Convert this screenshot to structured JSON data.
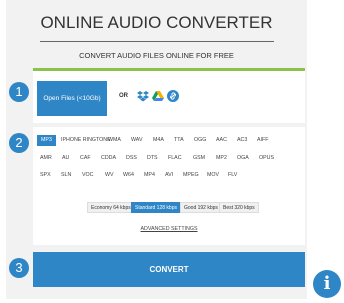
{
  "header": {
    "title": "ONLINE AUDIO CONVERTER",
    "subtitle": "CONVERT AUDIO FILES ONLINE FOR FREE"
  },
  "steps": [
    "1",
    "2",
    "3"
  ],
  "upload": {
    "open_label": "Open Files (<10Gb)",
    "or_label": "OR",
    "sources": [
      "dropbox-icon",
      "google-drive-icon",
      "url-link-icon"
    ]
  },
  "formats": {
    "row1": [
      "MP3",
      "IPHONE RINGTONE",
      "WMA",
      "WAV",
      "M4A",
      "TTA",
      "OGG",
      "AAC",
      "AC3",
      "AIFF"
    ],
    "row2": [
      "AMR",
      "AU",
      "CAF",
      "CDDA",
      "DSS",
      "DTS",
      "FLAC",
      "GSM",
      "MP2",
      "OGA",
      "OPUS"
    ],
    "row3": [
      "SPX",
      "SLN",
      "VOC",
      "WV",
      "W64",
      "MP4",
      "AVI",
      "MPEG",
      "MOV",
      "FLV"
    ],
    "selected": "MP3"
  },
  "quality": {
    "options": [
      "Economy 64 kbps",
      "Standard 128 kbps",
      "Good 192 kbps",
      "Best 320 kbps"
    ],
    "selected": "Standard 128 kbps"
  },
  "advanced_label": "ADVANCED SETTINGS",
  "convert_label": "CONVERT",
  "info_label": "i",
  "colors": {
    "accent": "#2f86c6",
    "progress": "#8bc34a",
    "panel": "#f2f2f2"
  }
}
